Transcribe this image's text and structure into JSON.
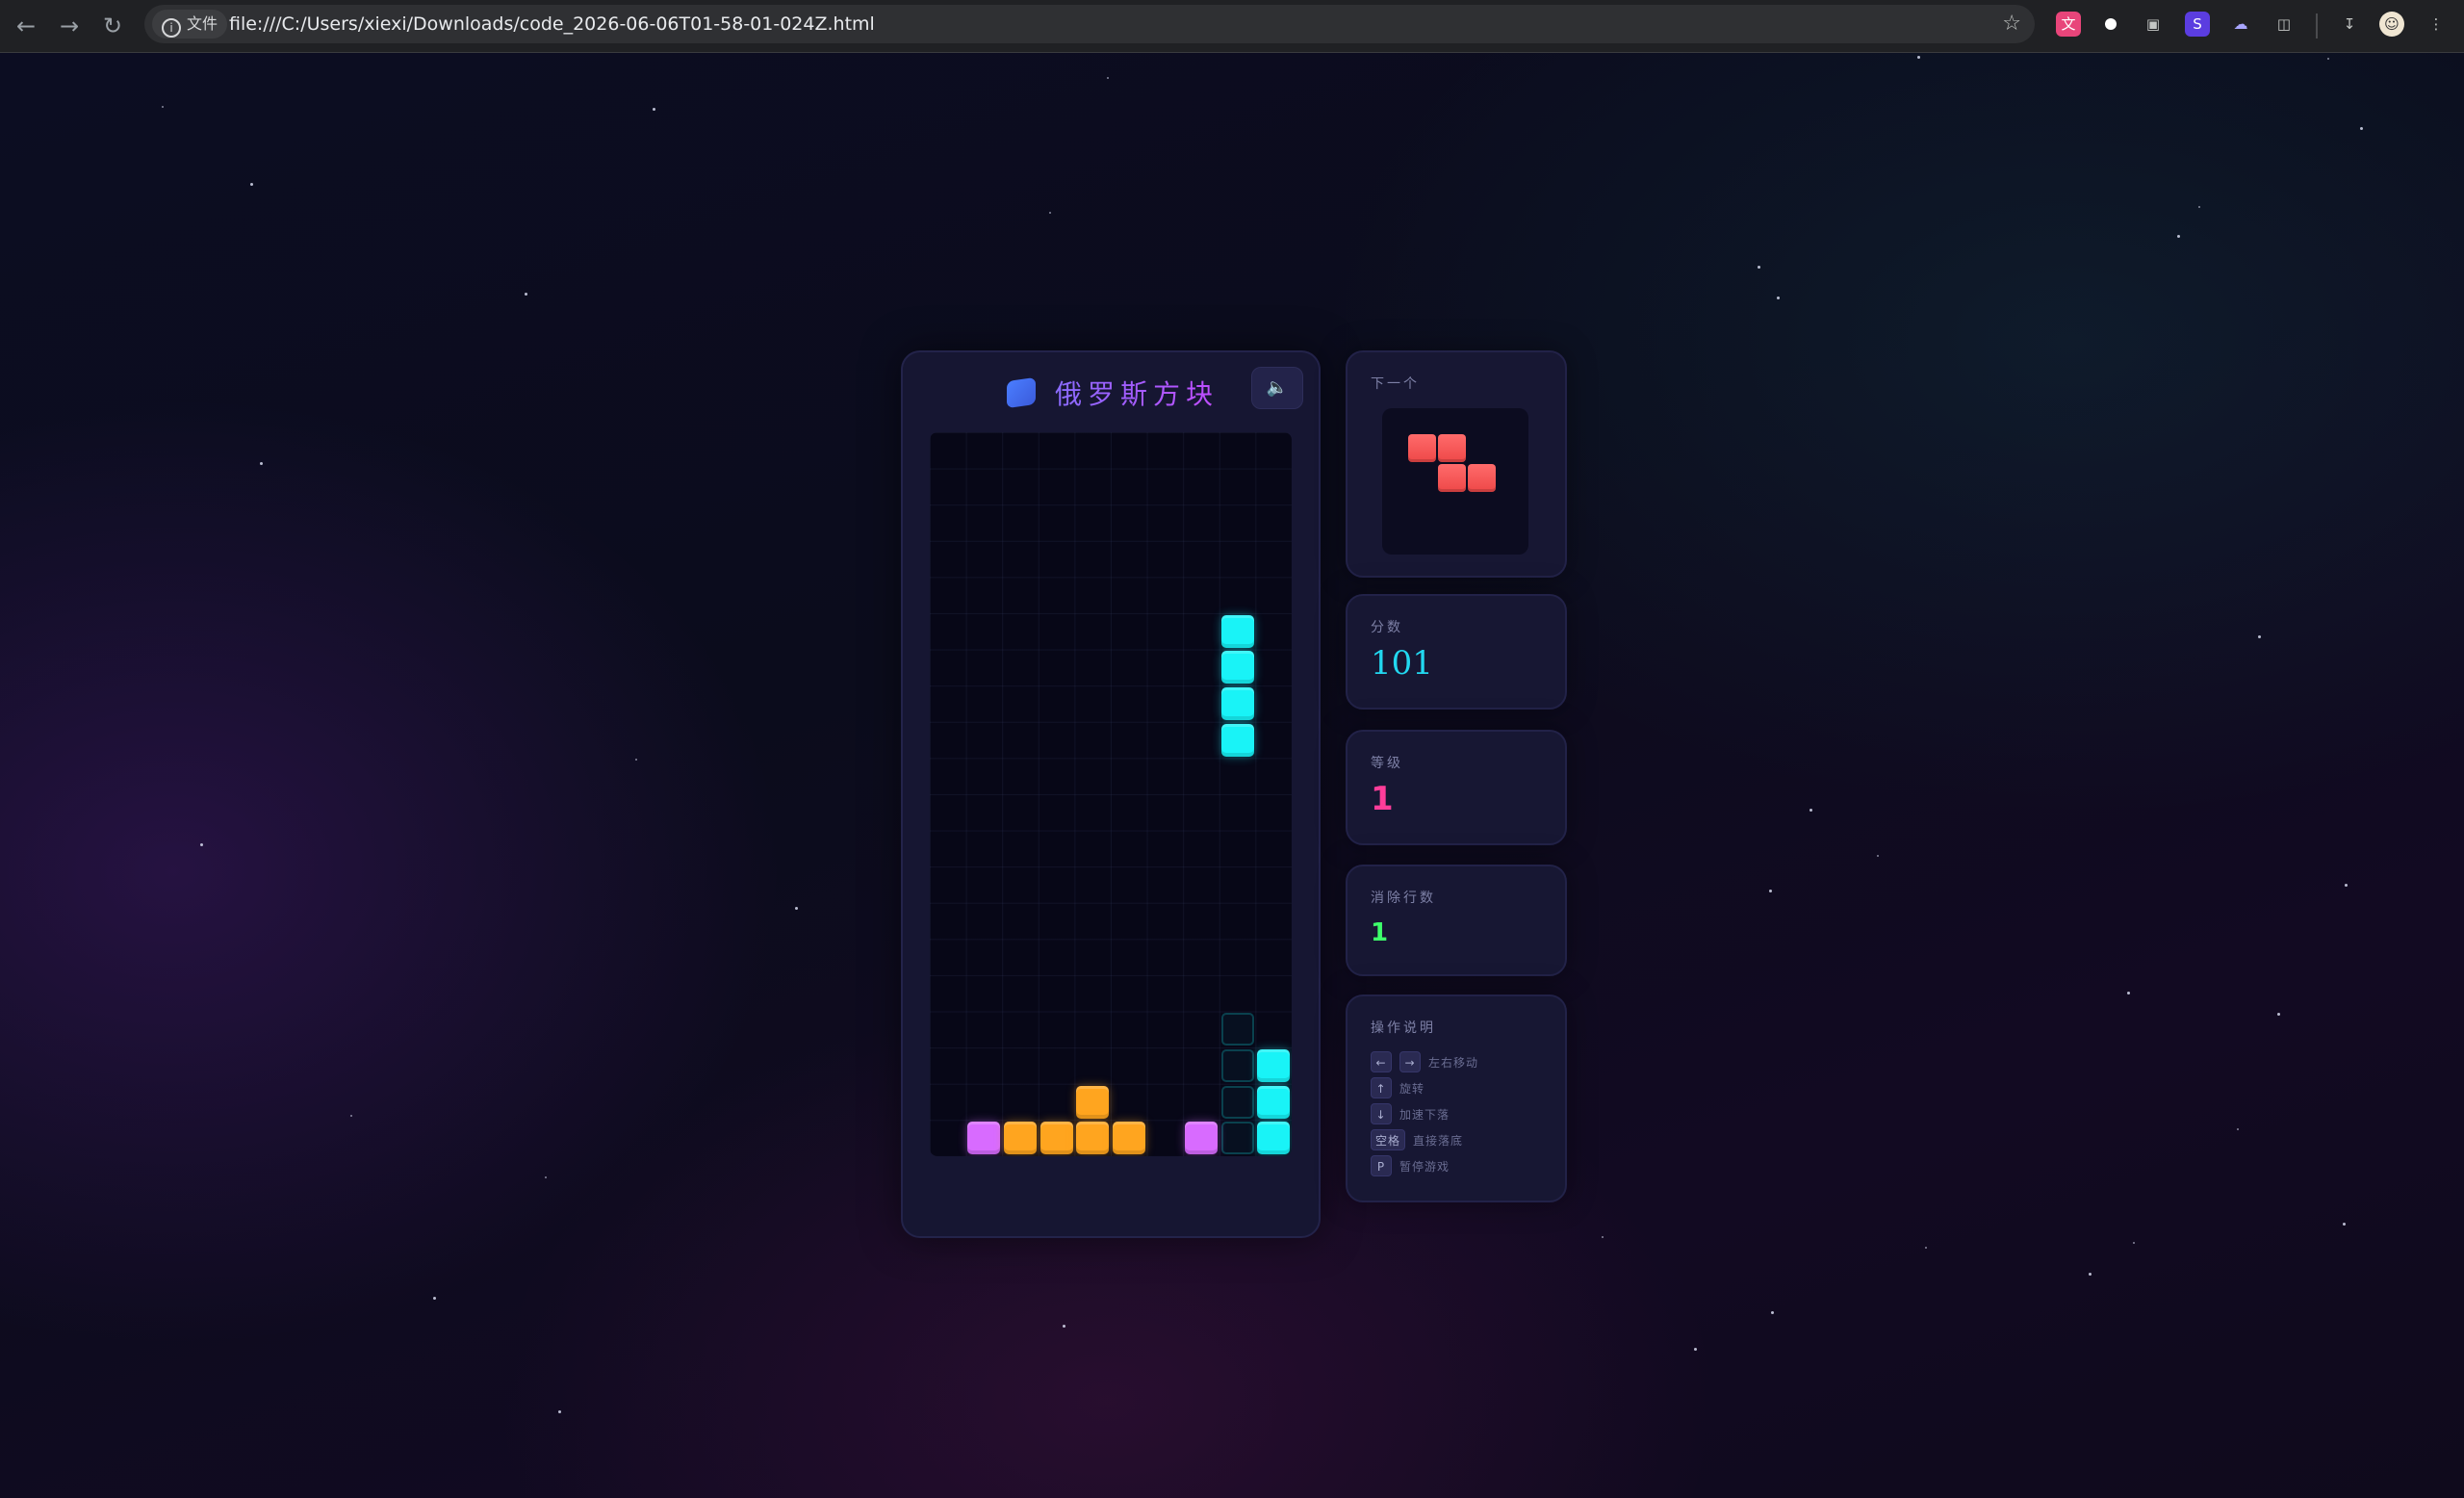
{
  "browser": {
    "file_chip_label": "文件",
    "url": "file:///C:/Users/xiexi/Downloads/code_2026-06-06T01-58-01-024Z.html",
    "icons": [
      "back-icon",
      "forward-icon",
      "reload-icon",
      "info-icon",
      "star-icon",
      "download-icon",
      "profile-icon",
      "menu-icon"
    ]
  },
  "game": {
    "title": "俄罗斯方块",
    "sound_icon": "speaker-icon",
    "board": {
      "cols": 10,
      "rows": 20,
      "cells": [
        {
          "col": 8,
          "row": 5,
          "color": "#19f3f7",
          "kind": "active"
        },
        {
          "col": 8,
          "row": 6,
          "color": "#19f3f7",
          "kind": "active"
        },
        {
          "col": 8,
          "row": 7,
          "color": "#19f3f7",
          "kind": "active"
        },
        {
          "col": 8,
          "row": 8,
          "color": "#19f3f7",
          "kind": "active"
        },
        {
          "col": 8,
          "row": 16,
          "color": "#19f3f7",
          "kind": "ghost"
        },
        {
          "col": 8,
          "row": 17,
          "color": "#19f3f7",
          "kind": "ghost"
        },
        {
          "col": 8,
          "row": 18,
          "color": "#19f3f7",
          "kind": "ghost"
        },
        {
          "col": 8,
          "row": 19,
          "color": "#19f3f7",
          "kind": "ghost"
        },
        {
          "col": 9,
          "row": 17,
          "color": "#19f3f7",
          "kind": "locked"
        },
        {
          "col": 9,
          "row": 18,
          "color": "#19f3f7",
          "kind": "locked"
        },
        {
          "col": 9,
          "row": 19,
          "color": "#19f3f7",
          "kind": "locked"
        },
        {
          "col": 4,
          "row": 18,
          "color": "#ffa51f",
          "kind": "locked"
        },
        {
          "col": 1,
          "row": 19,
          "color": "#d86bff",
          "kind": "locked"
        },
        {
          "col": 2,
          "row": 19,
          "color": "#ffa51f",
          "kind": "locked"
        },
        {
          "col": 3,
          "row": 19,
          "color": "#ffa51f",
          "kind": "locked"
        },
        {
          "col": 4,
          "row": 19,
          "color": "#ffa51f",
          "kind": "locked"
        },
        {
          "col": 5,
          "row": 19,
          "color": "#ffa51f",
          "kind": "locked"
        },
        {
          "col": 7,
          "row": 19,
          "color": "#d86bff",
          "kind": "locked"
        }
      ]
    }
  },
  "next": {
    "label": "下一个",
    "piece": "Z",
    "color": "#ff5a5a",
    "cells": [
      [
        0,
        0
      ],
      [
        1,
        0
      ],
      [
        1,
        1
      ],
      [
        2,
        1
      ]
    ]
  },
  "score": {
    "label": "分数",
    "value": "101"
  },
  "level": {
    "label": "等级",
    "value": "1"
  },
  "lines": {
    "label": "消除行数",
    "value": "1"
  },
  "controls": {
    "label": "操作说明",
    "rows": [
      {
        "keys": [
          "←",
          "→"
        ],
        "desc": "左右移动"
      },
      {
        "keys": [
          "↑"
        ],
        "desc": "旋转"
      },
      {
        "keys": [
          "↓"
        ],
        "desc": "加速下落"
      },
      {
        "keys": [
          "空格"
        ],
        "desc": "直接落底"
      },
      {
        "keys": [
          "P"
        ],
        "desc": "暂停游戏"
      }
    ]
  }
}
